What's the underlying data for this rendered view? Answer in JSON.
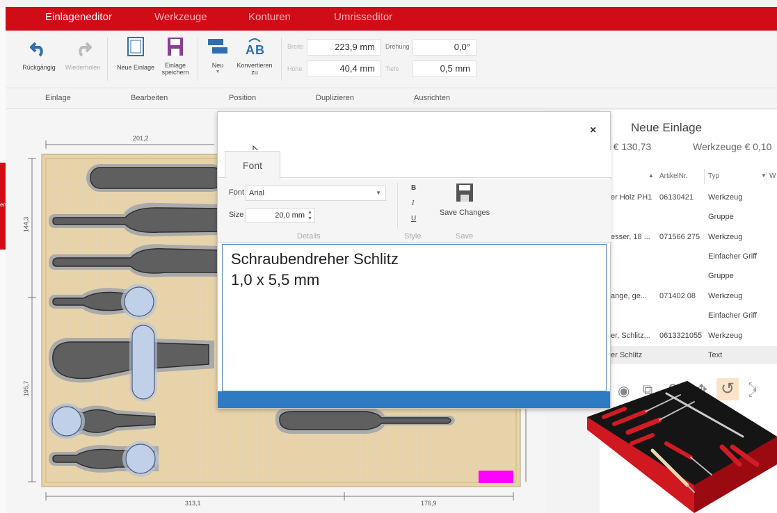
{
  "tabs": [
    "Einlageneditor",
    "Werkzeuge",
    "Konturen",
    "Umrisseditor"
  ],
  "ribbon": {
    "undo": "Rückgängig",
    "redo": "Wiederholen",
    "new_insert": "Neue Einlage",
    "save_insert_1": "Einlage",
    "save_insert_2": "speichern",
    "new": "Neu",
    "convert_1": "Konvertieren",
    "convert_2": "zu",
    "width_label": "Breite",
    "width_value": "223,9 mm",
    "height_label": "Höhe",
    "height_value": "40,4 mm",
    "rotation_label": "Drehung",
    "rotation_value": "0,0°",
    "depth_label": "Tiefe",
    "depth_value": "0,5 mm",
    "groups": [
      "Einlage",
      "Bearbeiten",
      "Position",
      "Duplizieren",
      "Ausrichten"
    ]
  },
  "canvas": {
    "dim_top": "201,2",
    "dim_left_top": "144,3",
    "dim_left_bottom": "195,7",
    "dim_bottom_left": "313,1",
    "dim_bottom_right": "176,9",
    "left_stub": "en"
  },
  "dialog": {
    "close": "×",
    "tab": "Font",
    "font_label": "Font",
    "font_value": "Arial",
    "size_label": "Size",
    "size_value": "20,0 mm",
    "bold": "B",
    "italic": "I",
    "underline": "U",
    "save": "Save Changes",
    "group_details": "Details",
    "group_style": "Style",
    "group_save": "Save",
    "text": "Schraubendreher Schlitz\n1,0 x 5,5 mm"
  },
  "right_panel": {
    "title": "Neue Einlage",
    "price_left": "e € 130,73",
    "price_right": "Werkzeuge € 0,10",
    "headers": [
      "ArtikelNr.",
      "Typ",
      "W"
    ],
    "rows": [
      {
        "name": "er Holz PH1",
        "art": "06130421",
        "type": "Werkzeug"
      },
      {
        "name": "",
        "art": "",
        "type": "Gruppe"
      },
      {
        "name": "esser, 18 ...",
        "art": "071566 275",
        "type": "Werkzeug"
      },
      {
        "name": "",
        "art": "",
        "type": "Einfacher Griff"
      },
      {
        "name": "",
        "art": "",
        "type": "Gruppe"
      },
      {
        "name": "ange, ge...",
        "art": "071402 08",
        "type": "Werkzeug"
      },
      {
        "name": "",
        "art": "",
        "type": "Einfacher Griff"
      },
      {
        "name": "er, Schlitz...",
        "art": "0613321055",
        "type": "Werkzeug"
      },
      {
        "name": "er Schlitz",
        "art": "",
        "type": "Text"
      }
    ]
  },
  "colors": {
    "brand": "#d00d17",
    "accent": "#2d7bc3",
    "highlight": "#ff00ff"
  }
}
